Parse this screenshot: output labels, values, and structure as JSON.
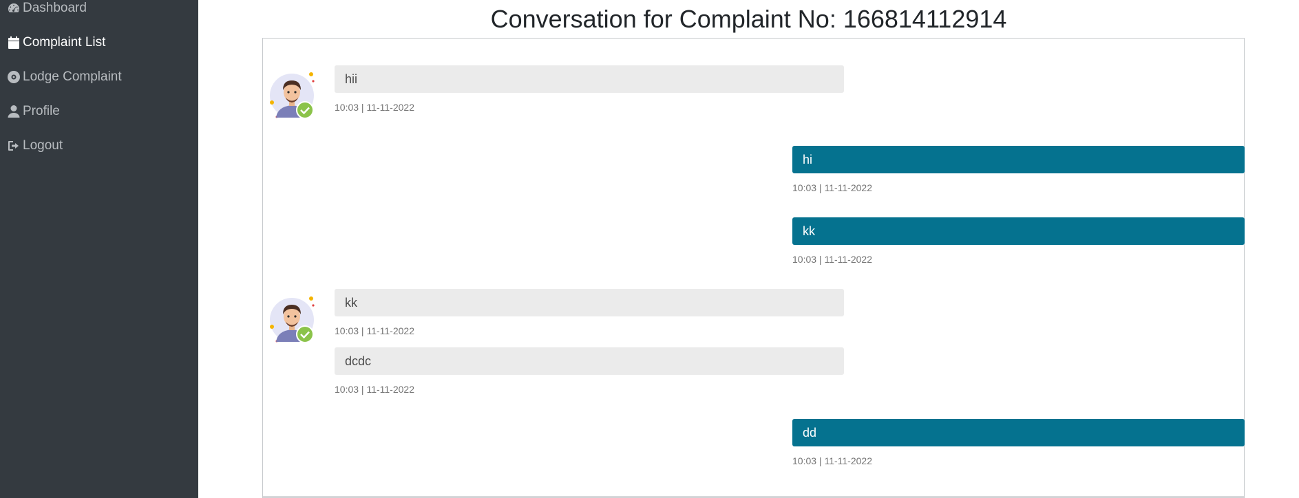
{
  "sidebar": {
    "items": [
      {
        "label": "Dashboard",
        "icon": "dashboard-icon"
      },
      {
        "label": "Complaint List",
        "icon": "calendar-icon",
        "active": true
      },
      {
        "label": "Lodge Complaint",
        "icon": "disc-icon"
      },
      {
        "label": "Profile",
        "icon": "user-icon"
      },
      {
        "label": "Logout",
        "icon": "logout-icon"
      }
    ]
  },
  "page": {
    "title": "Conversation for Complaint No: 166814112914"
  },
  "colors": {
    "sidebar_bg": "#343a40",
    "outgoing_bubble": "#05728f",
    "incoming_bubble": "#ebebeb"
  },
  "messages": [
    {
      "direction": "incoming",
      "text": "hii",
      "time": "10:03 | 11-11-2022"
    },
    {
      "direction": "outgoing",
      "text": "hi",
      "time": "10:03 | 11-11-2022"
    },
    {
      "direction": "outgoing",
      "text": "kk",
      "time": "10:03 | 11-11-2022"
    },
    {
      "direction": "incoming",
      "text": "kk",
      "time": "10:03 | 11-11-2022"
    },
    {
      "direction": "incoming",
      "text": "dcdc",
      "time": "10:03 | 11-11-2022"
    },
    {
      "direction": "outgoing",
      "text": "dd",
      "time": "10:03 | 11-11-2022"
    }
  ]
}
